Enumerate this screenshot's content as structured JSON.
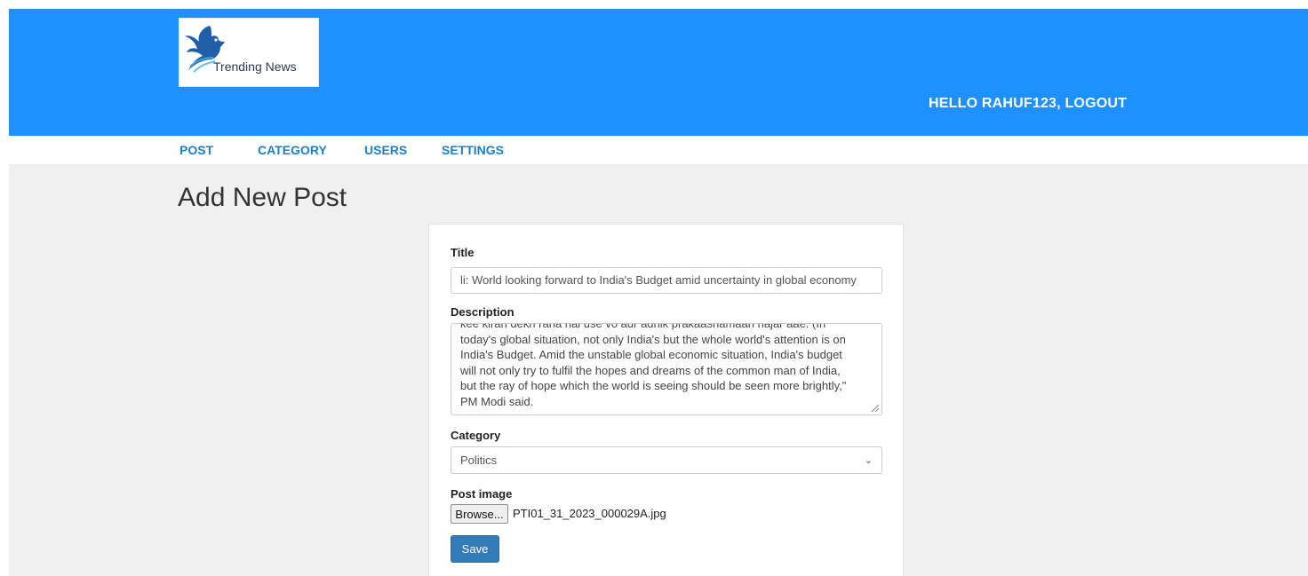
{
  "header": {
    "logo_text": "Trending News",
    "greeting": "HELLO RAHUF123,",
    "logout_label": "LOGOUT",
    "background_color": "#1e90ff"
  },
  "nav": {
    "items": [
      {
        "label": "POST"
      },
      {
        "label": "CATEGORY"
      },
      {
        "label": "USERS"
      },
      {
        "label": "SETTINGS"
      }
    ]
  },
  "main": {
    "page_title": "Add New Post",
    "form": {
      "title_label": "Title",
      "title_value": "li: World looking forward to India's Budget amid uncertainty in global economy",
      "description_label": "Description",
      "description_lines": [
        "kee kiran dekh raha hai use vo aur adhik prakaashamaan najar aae. (In",
        "today's global situation, not only India's but the whole world's attention is on",
        "India's Budget. Amid the unstable global economic situation, India's budget",
        "will not only try to fulfil the hopes and dreams of the common man of India,",
        "but the ray of hope which the world is seeing should be seen more brightly,\"",
        "PM Modi said."
      ],
      "category_label": "Category",
      "category_selected": "Politics",
      "image_label": "Post image",
      "browse_label": "Browse...",
      "file_name": "PTI01_31_2023_000029A.jpg",
      "save_label": "Save"
    }
  },
  "icons": {
    "logo": "bird-logo-icon",
    "select_arrow": "chevron-down-icon",
    "resize": "resize-handle-icon"
  },
  "colors": {
    "nav_link": "#1e7fc1",
    "save_button": "#337ab7",
    "content_bg": "#f0f0f0"
  }
}
